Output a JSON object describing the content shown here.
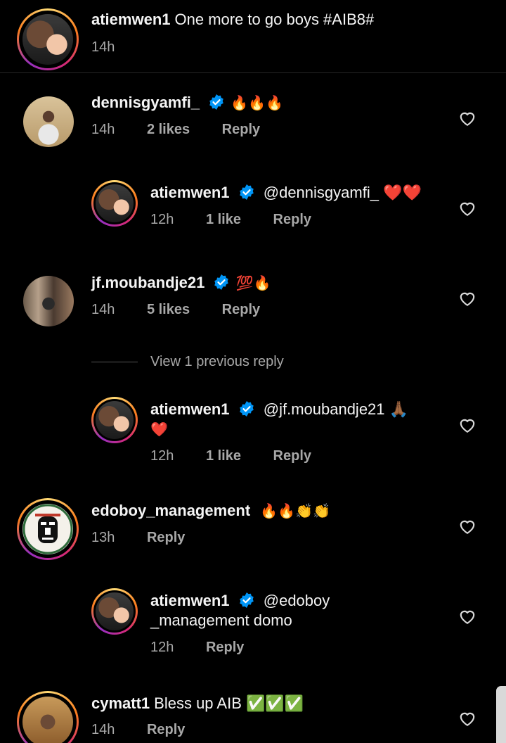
{
  "caption": {
    "username": "atiemwen1",
    "text": "One more to go boys #AIB8#",
    "time": "14h"
  },
  "comments": [
    {
      "username": "dennisgyamfi_",
      "verified": true,
      "text": "🔥🔥🔥",
      "time": "14h",
      "likes": "2 likes",
      "reply": "Reply"
    },
    {
      "username": "atiemwen1",
      "verified": true,
      "text": "@dennisgyamfi_ ❤️❤️",
      "time": "12h",
      "likes": "1 like",
      "reply": "Reply"
    },
    {
      "username": "jf.moubandje21",
      "verified": true,
      "text": "💯🔥",
      "time": "14h",
      "likes": "5 likes",
      "reply": "Reply"
    },
    {
      "view_previous": "View 1 previous reply"
    },
    {
      "username": "atiemwen1",
      "verified": true,
      "text": "@jf.moubandje21 🙏🏾",
      "text_line2": "❤️",
      "time": "12h",
      "likes": "1 like",
      "reply": "Reply"
    },
    {
      "username": "edoboy_management",
      "verified": false,
      "text": "🔥🔥👏👏",
      "time": "13h",
      "reply": "Reply"
    },
    {
      "username": "atiemwen1",
      "verified": true,
      "text": "@edoboy",
      "text_line2": "_management domo",
      "time": "12h",
      "reply": "Reply"
    },
    {
      "username": "cymatt1",
      "verified": false,
      "text": "Bless up AIB ✅✅✅",
      "time": "14h",
      "reply": "Reply"
    }
  ],
  "colors": {
    "verified_badge": "#0095f6",
    "meta_text": "#a8a8a8"
  },
  "icons": {
    "like": "heart-outline-icon",
    "verified": "verified-badge-icon"
  }
}
